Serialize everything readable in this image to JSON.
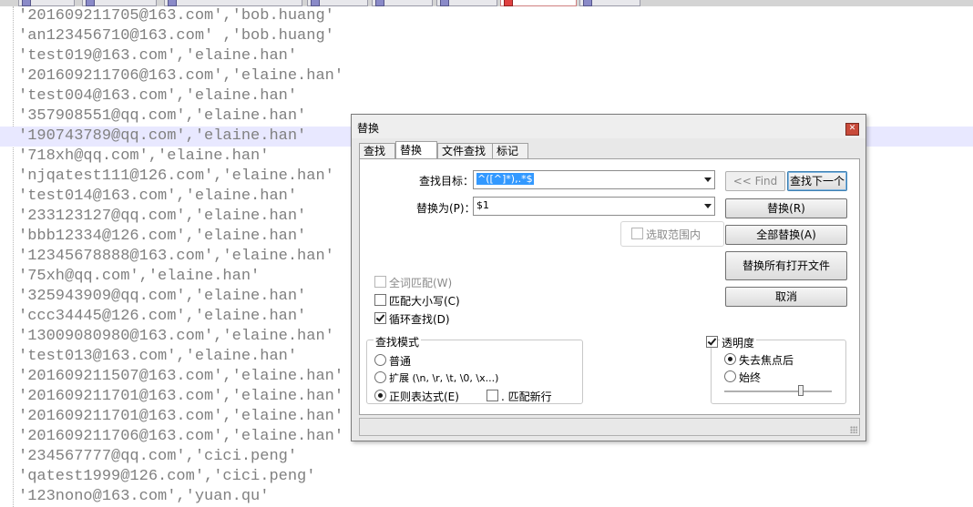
{
  "editor": {
    "lines": [
      "'201609211705@163.com','bob.huang'",
      "'an123456710@163.com' ,'bob.huang'",
      "'test019@163.com','elaine.han'",
      "'201609211706@163.com','elaine.han'",
      "'test004@163.com','elaine.han'",
      "'357908551@qq.com','elaine.han'",
      "'190743789@qq.com','elaine.han'",
      "'718xh@qq.com','elaine.han'",
      "'njqatest111@126.com','elaine.han'",
      "'test014@163.com','elaine.han'",
      "'233123127@qq.com','elaine.han'",
      "'bbb12334@126.com','elaine.han'",
      "'12345678888@163.com','elaine.han'",
      "'75xh@qq.com','elaine.han'",
      "'325943909@qq.com','elaine.han'",
      "'ccc34445@126.com','elaine.han'",
      "'13009080980@163.com','elaine.han'",
      "'test013@163.com','elaine.han'",
      "'201609211507@163.com','elaine.han'",
      "'201609211701@163.com','elaine.han'",
      "'201609211701@163.com','elaine.han'",
      "'201609211706@163.com','elaine.han'",
      "'234567777@qq.com','cici.peng'",
      "'qatest1999@126.com','cici.peng'",
      "'123nono@163.com','yuan.qu'"
    ],
    "current_line": 6
  },
  "dialog": {
    "title": "替换",
    "tabs": [
      "查找",
      "替换",
      "文件查找",
      "标记"
    ],
    "find_label": "查找目标：",
    "find_value": "^([^]*),.*$",
    "replace_label": "替换为(P)：",
    "replace_value": "$1",
    "buttons": {
      "find_prev": "<< Find",
      "find_next": "查找下一个",
      "replace": "替换(R)",
      "replace_all": "全部替换(A)",
      "replace_all_open": "替换所有打开文件",
      "cancel": "取消"
    },
    "in_selection": "选取范围内",
    "options": {
      "whole_word": "全词匹配(W)",
      "match_case": "匹配大小写(C)",
      "wrap_around": "循环查找(D)"
    },
    "search_mode": {
      "title": "查找模式",
      "normal": "普通",
      "extended": "扩展 (\\n, \\r, \\t, \\0, \\x...)",
      "regex": "正则表达式(E)",
      "dot_newline": ". 匹配新行"
    },
    "transparency": {
      "title": "透明度",
      "on_lose_focus": "失去焦点后",
      "always": "始终",
      "level": 0.7
    },
    "state": {
      "whole_word_checked": false,
      "match_case_checked": false,
      "wrap_around_checked": true,
      "in_selection_checked": false,
      "mode": "regex",
      "dot_newline_checked": false,
      "transparency_checked": true,
      "transparency_mode": "on_lose_focus"
    }
  }
}
